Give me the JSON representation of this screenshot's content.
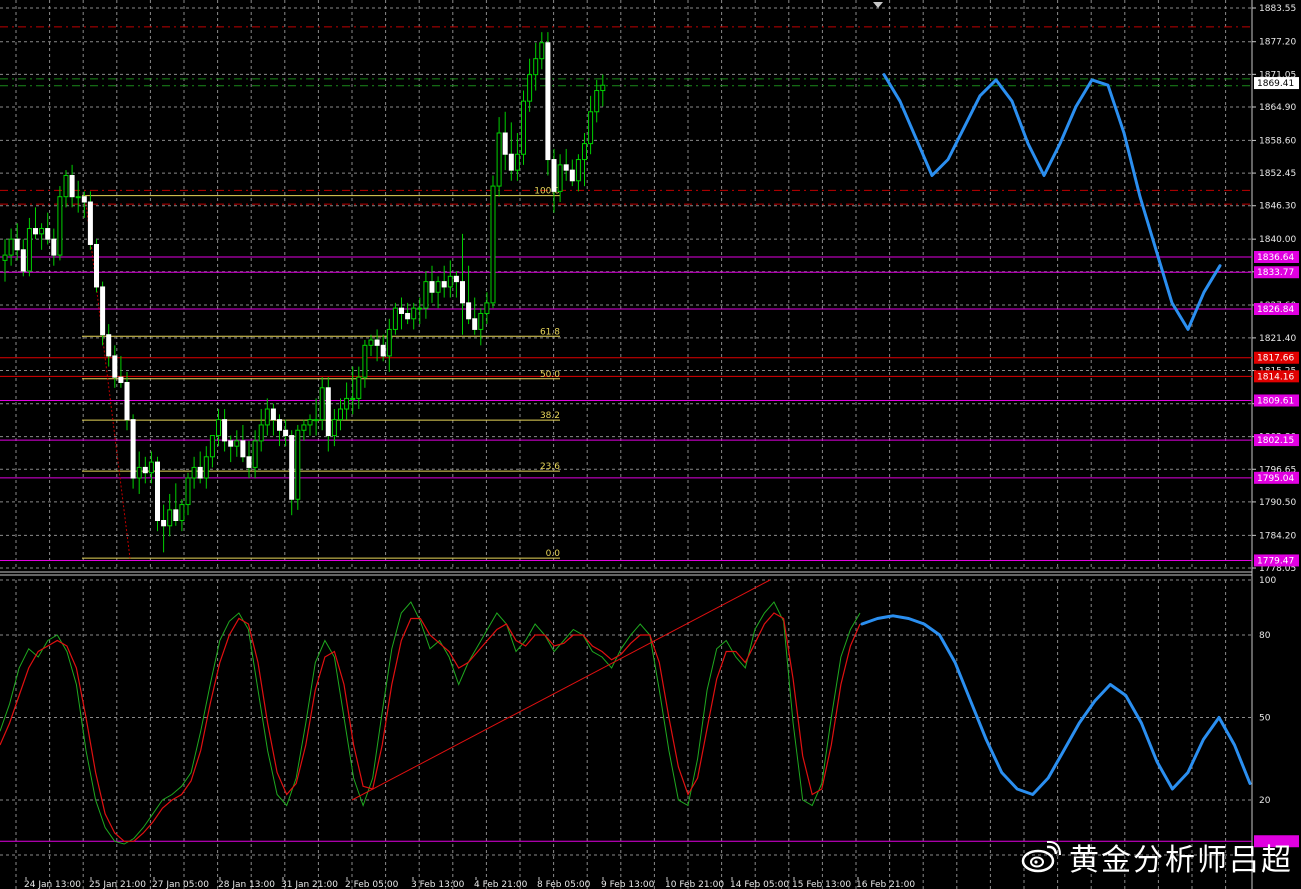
{
  "chart_data": [
    {
      "type": "candlestick",
      "title": "",
      "ylim": [
        1778.05,
        1883.55
      ],
      "y_ticks": [
        "1883.55",
        "1877.20",
        "1871.05",
        "1864.90",
        "1858.60",
        "1852.45",
        "1846.30",
        "1840.00",
        "1833.85",
        "1827.60",
        "1821.40",
        "1815.25",
        "1809.00",
        "1802.80",
        "1796.65",
        "1790.50",
        "1784.20",
        "1778.05"
      ],
      "x_labels": [
        "00",
        "24 Jan 13:00",
        "25 Jan 21:00",
        "27 Jan 05:00",
        "28 Jan 13:00",
        "31 Jan 21:00",
        "2 Feb 05:00",
        "3 Feb 13:00",
        "4 Feb 21:00",
        "8 Feb 05:00",
        "9 Feb 13:00",
        "10 Feb 21:00",
        "14 Feb 05:00",
        "15 Feb 13:00",
        "16 Feb 21:00"
      ],
      "current_price": "1869.41",
      "price_tags": [
        {
          "label": "1836.64",
          "value": 1836.64,
          "color": "#e000e0"
        },
        {
          "label": "1833.77",
          "value": 1833.77,
          "color": "#e000e0"
        },
        {
          "label": "1826.84",
          "value": 1826.84,
          "color": "#e000e0"
        },
        {
          "label": "1817.66",
          "value": 1817.66,
          "color": "#e00000"
        },
        {
          "label": "1814.16",
          "value": 1814.16,
          "color": "#e00000"
        },
        {
          "label": "1809.61",
          "value": 1809.61,
          "color": "#e000e0"
        },
        {
          "label": "1802.15",
          "value": 1802.15,
          "color": "#e000e0"
        },
        {
          "label": "1795.04",
          "value": 1795.04,
          "color": "#e000e0"
        },
        {
          "label": "1779.47",
          "value": 1779.47,
          "color": "#e000e0"
        }
      ],
      "dashed_levels": [
        {
          "value": 1880.0,
          "color": "#c00000"
        },
        {
          "value": 1870.2,
          "color": "#1a8a1a"
        },
        {
          "value": 1868.9,
          "color": "#1a8a1a"
        },
        {
          "value": 1849.2,
          "color": "#c00000"
        },
        {
          "value": 1846.6,
          "color": "#c00000"
        }
      ],
      "fibonacci": [
        {
          "label": "100.0",
          "value": 1848.2
        },
        {
          "label": "61.8",
          "value": 1821.7
        },
        {
          "label": "50.0",
          "value": 1813.7
        },
        {
          "label": "38.2",
          "value": 1805.9
        },
        {
          "label": "23.6",
          "value": 1796.3
        },
        {
          "label": "0.0",
          "value": 1779.9
        }
      ],
      "candles": [
        [
          1836,
          1840,
          1832,
          1837
        ],
        [
          1837,
          1842,
          1835,
          1840
        ],
        [
          1840,
          1843,
          1836,
          1838
        ],
        [
          1838,
          1840,
          1833,
          1834
        ],
        [
          1834,
          1844,
          1833,
          1842
        ],
        [
          1842,
          1846,
          1840,
          1841
        ],
        [
          1841,
          1843,
          1838,
          1842
        ],
        [
          1842,
          1845,
          1839,
          1840
        ],
        [
          1840,
          1842,
          1835,
          1837
        ],
        [
          1837,
          1850,
          1836,
          1848
        ],
        [
          1848,
          1853,
          1846,
          1852
        ],
        [
          1852,
          1854,
          1846,
          1848
        ],
        [
          1848,
          1851,
          1845,
          1848
        ],
        [
          1848,
          1849,
          1844,
          1847
        ],
        [
          1847,
          1849,
          1838,
          1839
        ],
        [
          1839,
          1840,
          1830,
          1831
        ],
        [
          1831,
          1832,
          1820,
          1822
        ],
        [
          1822,
          1824,
          1816,
          1818
        ],
        [
          1818,
          1820,
          1812,
          1814
        ],
        [
          1814,
          1818,
          1812,
          1813
        ],
        [
          1813,
          1815,
          1804,
          1806
        ],
        [
          1806,
          1807,
          1793,
          1795
        ],
        [
          1795,
          1800,
          1792,
          1797
        ],
        [
          1797,
          1799,
          1794,
          1796
        ],
        [
          1796,
          1800,
          1794,
          1798
        ],
        [
          1798,
          1799,
          1785,
          1787
        ],
        [
          1787,
          1790,
          1781,
          1786
        ],
        [
          1786,
          1792,
          1784,
          1789
        ],
        [
          1789,
          1794,
          1786,
          1787
        ],
        [
          1787,
          1791,
          1785,
          1790
        ],
        [
          1790,
          1796,
          1788,
          1795
        ],
        [
          1795,
          1799,
          1793,
          1797
        ],
        [
          1797,
          1800,
          1794,
          1795
        ],
        [
          1795,
          1801,
          1793,
          1799
        ],
        [
          1799,
          1803,
          1797,
          1803
        ],
        [
          1803,
          1808,
          1801,
          1806
        ],
        [
          1806,
          1808,
          1800,
          1802
        ],
        [
          1802,
          1803,
          1798,
          1801
        ],
        [
          1801,
          1804,
          1799,
          1802
        ],
        [
          1802,
          1805,
          1798,
          1799
        ],
        [
          1799,
          1802,
          1795,
          1797
        ],
        [
          1797,
          1804,
          1795,
          1802
        ],
        [
          1802,
          1808,
          1800,
          1805
        ],
        [
          1805,
          1810,
          1803,
          1808
        ],
        [
          1808,
          1809,
          1803,
          1806
        ],
        [
          1806,
          1807,
          1801,
          1804
        ],
        [
          1804,
          1806,
          1801,
          1803
        ],
        [
          1803,
          1804,
          1788,
          1791
        ],
        [
          1791,
          1805,
          1789,
          1804
        ],
        [
          1804,
          1806,
          1802,
          1805
        ],
        [
          1805,
          1807,
          1803,
          1806
        ],
        [
          1806,
          1810,
          1803,
          1806
        ],
        [
          1806,
          1814,
          1804,
          1812
        ],
        [
          1812,
          1814,
          1800,
          1803
        ],
        [
          1803,
          1808,
          1801,
          1806
        ],
        [
          1806,
          1810,
          1804,
          1808
        ],
        [
          1808,
          1813,
          1806,
          1810
        ],
        [
          1810,
          1816,
          1807,
          1810
        ],
        [
          1810,
          1816,
          1808,
          1814
        ],
        [
          1814,
          1821,
          1812,
          1820
        ],
        [
          1820,
          1822,
          1818,
          1821
        ],
        [
          1821,
          1823,
          1817,
          1820
        ],
        [
          1820,
          1822,
          1817,
          1818
        ],
        [
          1818,
          1825,
          1815,
          1823
        ],
        [
          1823,
          1828,
          1822,
          1827
        ],
        [
          1827,
          1829,
          1823,
          1826
        ],
        [
          1826,
          1828,
          1824,
          1825
        ],
        [
          1825,
          1828,
          1823,
          1827
        ],
        [
          1827,
          1829,
          1824,
          1827
        ],
        [
          1827,
          1834,
          1825,
          1832
        ],
        [
          1832,
          1835,
          1828,
          1830
        ],
        [
          1830,
          1833,
          1827,
          1832
        ],
        [
          1832,
          1835,
          1829,
          1831
        ],
        [
          1831,
          1836,
          1829,
          1833
        ],
        [
          1833,
          1834,
          1829,
          1832
        ],
        [
          1832,
          1841,
          1822,
          1828
        ],
        [
          1828,
          1835,
          1824,
          1825
        ],
        [
          1825,
          1829,
          1822,
          1823
        ],
        [
          1823,
          1827,
          1820,
          1826
        ],
        [
          1826,
          1830,
          1824,
          1828
        ],
        [
          1828,
          1852,
          1827,
          1850
        ],
        [
          1850,
          1863,
          1848,
          1860
        ],
        [
          1860,
          1864,
          1853,
          1856
        ],
        [
          1856,
          1862,
          1851,
          1853
        ],
        [
          1853,
          1860,
          1851,
          1856
        ],
        [
          1856,
          1868,
          1854,
          1866
        ],
        [
          1866,
          1874,
          1864,
          1871
        ],
        [
          1871,
          1877,
          1868,
          1874
        ],
        [
          1874,
          1879,
          1872,
          1877
        ],
        [
          1877,
          1879,
          1852,
          1855
        ],
        [
          1855,
          1857,
          1845,
          1849
        ],
        [
          1849,
          1856,
          1847,
          1854
        ],
        [
          1854,
          1857,
          1851,
          1853
        ],
        [
          1853,
          1855,
          1850,
          1851
        ],
        [
          1851,
          1856,
          1849,
          1855
        ],
        [
          1855,
          1860,
          1850,
          1858
        ],
        [
          1858,
          1867,
          1856,
          1864
        ],
        [
          1864,
          1870,
          1862,
          1868
        ],
        [
          1868,
          1871,
          1865,
          1869
        ]
      ],
      "forecast_price": [
        1871,
        1866,
        1859,
        1852,
        1855,
        1861,
        1867,
        1870,
        1866,
        1858,
        1852,
        1858,
        1865,
        1870,
        1869,
        1860,
        1848,
        1838,
        1828,
        1823,
        1830,
        1835
      ]
    },
    {
      "type": "line",
      "title": "",
      "ylim": [
        0,
        100
      ],
      "y_ticks": [
        "100",
        "80",
        "50",
        "20",
        "0"
      ],
      "series": [
        {
          "values": [
            45,
            55,
            68,
            75,
            72,
            78,
            80,
            74,
            62,
            38,
            20,
            10,
            5,
            4,
            6,
            10,
            15,
            20,
            22,
            25,
            30,
            45,
            62,
            78,
            85,
            88,
            82,
            60,
            38,
            22,
            18,
            28,
            48,
            70,
            78,
            72,
            50,
            28,
            18,
            28,
            52,
            75,
            88,
            92,
            85,
            75,
            78,
            72,
            62,
            70,
            76,
            82,
            88,
            84,
            74,
            78,
            84,
            80,
            74,
            78,
            82,
            80,
            74,
            72,
            68,
            75,
            80,
            84,
            80,
            60,
            38,
            20,
            18,
            35,
            60,
            75,
            78,
            72,
            68,
            82,
            88,
            92,
            85,
            48,
            20,
            18,
            26,
            50,
            72,
            82,
            88
          ]
        },
        {
          "values": [
            40,
            48,
            58,
            68,
            74,
            76,
            78,
            76,
            68,
            50,
            30,
            15,
            8,
            5,
            5,
            8,
            12,
            17,
            20,
            22,
            27,
            38,
            55,
            70,
            80,
            86,
            84,
            70,
            48,
            30,
            22,
            26,
            40,
            60,
            72,
            74,
            62,
            40,
            25,
            24,
            40,
            62,
            78,
            86,
            86,
            80,
            77,
            74,
            68,
            70,
            74,
            78,
            82,
            84,
            78,
            76,
            80,
            80,
            76,
            77,
            80,
            80,
            76,
            74,
            71,
            73,
            77,
            80,
            80,
            70,
            50,
            32,
            22,
            28,
            46,
            64,
            74,
            74,
            70,
            77,
            84,
            88,
            86,
            64,
            36,
            22,
            24,
            40,
            62,
            76,
            84
          ]
        }
      ],
      "forecast_values": [
        84,
        86,
        87,
        86,
        84,
        80,
        70,
        56,
        42,
        30,
        24,
        22,
        28,
        38,
        48,
        56,
        62,
        58,
        48,
        34,
        24,
        30,
        42,
        50,
        40,
        26
      ]
    }
  ],
  "watermark": "黄金分析师吕超"
}
